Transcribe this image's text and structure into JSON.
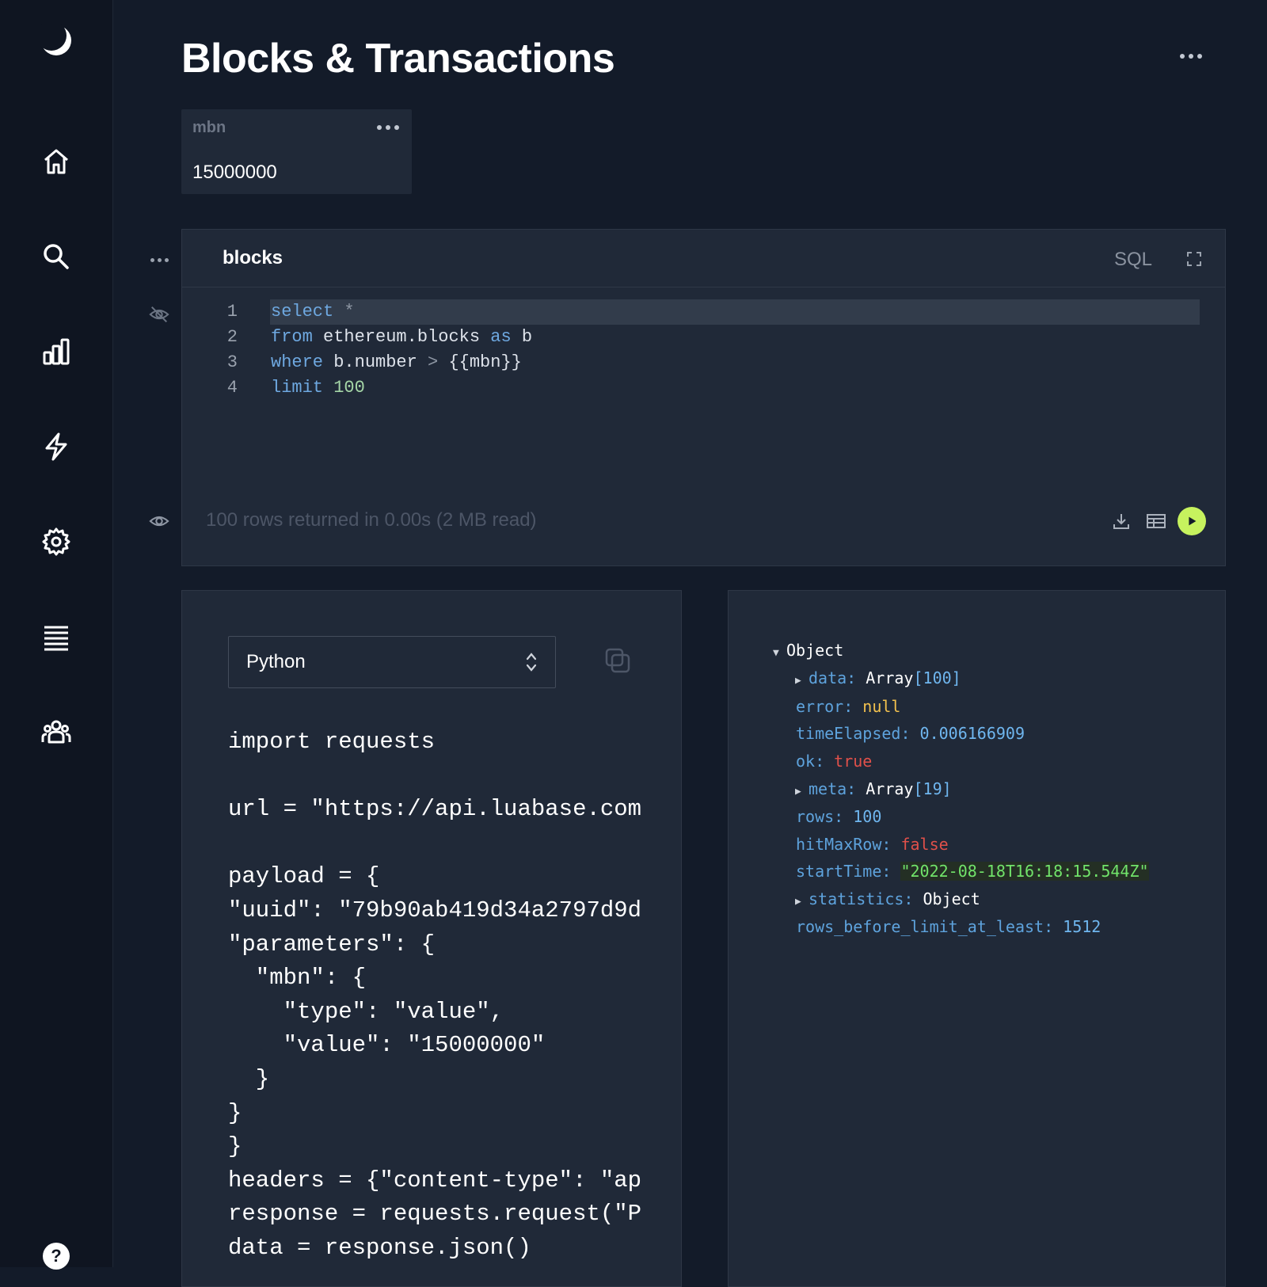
{
  "app": {
    "title": "Blocks & Transactions"
  },
  "sidebar": {
    "items": [
      {
        "icon": "home-icon"
      },
      {
        "icon": "search-icon"
      },
      {
        "icon": "bar-chart-icon"
      },
      {
        "icon": "lightning-icon"
      },
      {
        "icon": "gear-icon"
      },
      {
        "icon": "list-icon"
      },
      {
        "icon": "team-icon"
      },
      {
        "icon": "help-icon"
      }
    ]
  },
  "parameter": {
    "label": "mbn",
    "value": "15000000"
  },
  "query": {
    "name": "blocks",
    "language": "SQL",
    "lines": [
      {
        "n": "1",
        "parts": [
          {
            "t": "select",
            "c": "kw"
          },
          {
            "t": " ",
            "c": ""
          },
          {
            "t": "*",
            "c": "op"
          }
        ]
      },
      {
        "n": "2",
        "parts": [
          {
            "t": "from",
            "c": "kw"
          },
          {
            "t": " ethereum.blocks ",
            "c": ""
          },
          {
            "t": "as",
            "c": "kw"
          },
          {
            "t": " b",
            "c": ""
          }
        ]
      },
      {
        "n": "3",
        "parts": [
          {
            "t": "where",
            "c": "kw"
          },
          {
            "t": " b.number ",
            "c": ""
          },
          {
            "t": ">",
            "c": "op"
          },
          {
            "t": " {{mbn}}",
            "c": ""
          }
        ]
      },
      {
        "n": "4",
        "parts": [
          {
            "t": "limit",
            "c": "kw"
          },
          {
            "t": " ",
            "c": ""
          },
          {
            "t": "100",
            "c": "num"
          }
        ]
      }
    ],
    "status": "100 rows returned in 0.00s (2 MB read)"
  },
  "snippet": {
    "language": "Python",
    "code": [
      "import requests",
      "",
      "url = \"https://api.luabase.com",
      "",
      "payload = {",
      "\"uuid\": \"79b90ab419d34a2797d9d",
      "\"parameters\": {",
      "  \"mbn\": {",
      "    \"type\": \"value\",",
      "    \"value\": \"15000000\"",
      "  }",
      "}",
      "}",
      "headers = {\"content-type\": \"ap",
      "response = requests.request(\"P",
      "data = response.json()"
    ]
  },
  "result": {
    "root": "Object",
    "rows": [
      {
        "indent": 1,
        "expand": true,
        "key": "data",
        "parts": [
          {
            "t": "Array",
            "c": "jw"
          },
          {
            "t": "[100]",
            "c": "jbr"
          }
        ]
      },
      {
        "indent": 1,
        "expand": false,
        "key": "error",
        "parts": [
          {
            "t": "null",
            "c": "jnull"
          }
        ]
      },
      {
        "indent": 1,
        "expand": false,
        "key": "timeElapsed",
        "parts": [
          {
            "t": "0.006166909",
            "c": "jnum"
          }
        ]
      },
      {
        "indent": 1,
        "expand": false,
        "key": "ok",
        "parts": [
          {
            "t": "true",
            "c": "jbool"
          }
        ]
      },
      {
        "indent": 1,
        "expand": true,
        "key": "meta",
        "parts": [
          {
            "t": "Array",
            "c": "jw"
          },
          {
            "t": "[19]",
            "c": "jbr"
          }
        ]
      },
      {
        "indent": 1,
        "expand": false,
        "key": "rows",
        "parts": [
          {
            "t": "100",
            "c": "jnum"
          }
        ]
      },
      {
        "indent": 1,
        "expand": false,
        "key": "hitMaxRow",
        "parts": [
          {
            "t": "false",
            "c": "jbool"
          }
        ]
      },
      {
        "indent": 1,
        "expand": false,
        "key": "startTime",
        "parts": [
          {
            "t": "\"2022-08-18T16:18:15.544Z\"",
            "c": "jstr"
          }
        ]
      },
      {
        "indent": 1,
        "expand": true,
        "key": "statistics",
        "parts": [
          {
            "t": "Object",
            "c": "jw"
          }
        ]
      },
      {
        "indent": 1,
        "expand": false,
        "key": "rows_before_limit_at_least",
        "parts": [
          {
            "t": "1512",
            "c": "jnum"
          }
        ]
      }
    ]
  },
  "colors": {
    "background": "#131b29",
    "panel": "#202938",
    "accent": "#c6f25e",
    "keyword": "#6ea8e0"
  }
}
